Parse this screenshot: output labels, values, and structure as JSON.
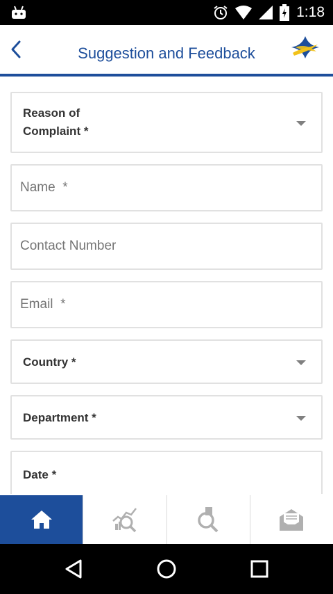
{
  "status_bar": {
    "time": "1:18"
  },
  "header": {
    "title": "Suggestion and Feedback"
  },
  "form": {
    "reason": {
      "label": "Reason of\nComplaint *"
    },
    "name": {
      "placeholder": "Name  *"
    },
    "contact": {
      "placeholder": "Contact Number"
    },
    "email": {
      "placeholder": "Email  *"
    },
    "country": {
      "label": "Country *"
    },
    "department": {
      "label": "Department *"
    },
    "date": {
      "label": "Date *"
    }
  },
  "tabs": [
    {
      "icon": "home-icon"
    },
    {
      "icon": "chart-search-icon"
    },
    {
      "icon": "document-search-icon"
    },
    {
      "icon": "envelope-icon"
    }
  ],
  "colors": {
    "brand": "#1d4e9b",
    "border": "#e1e1e1",
    "placeholder": "#a8a8a8"
  }
}
